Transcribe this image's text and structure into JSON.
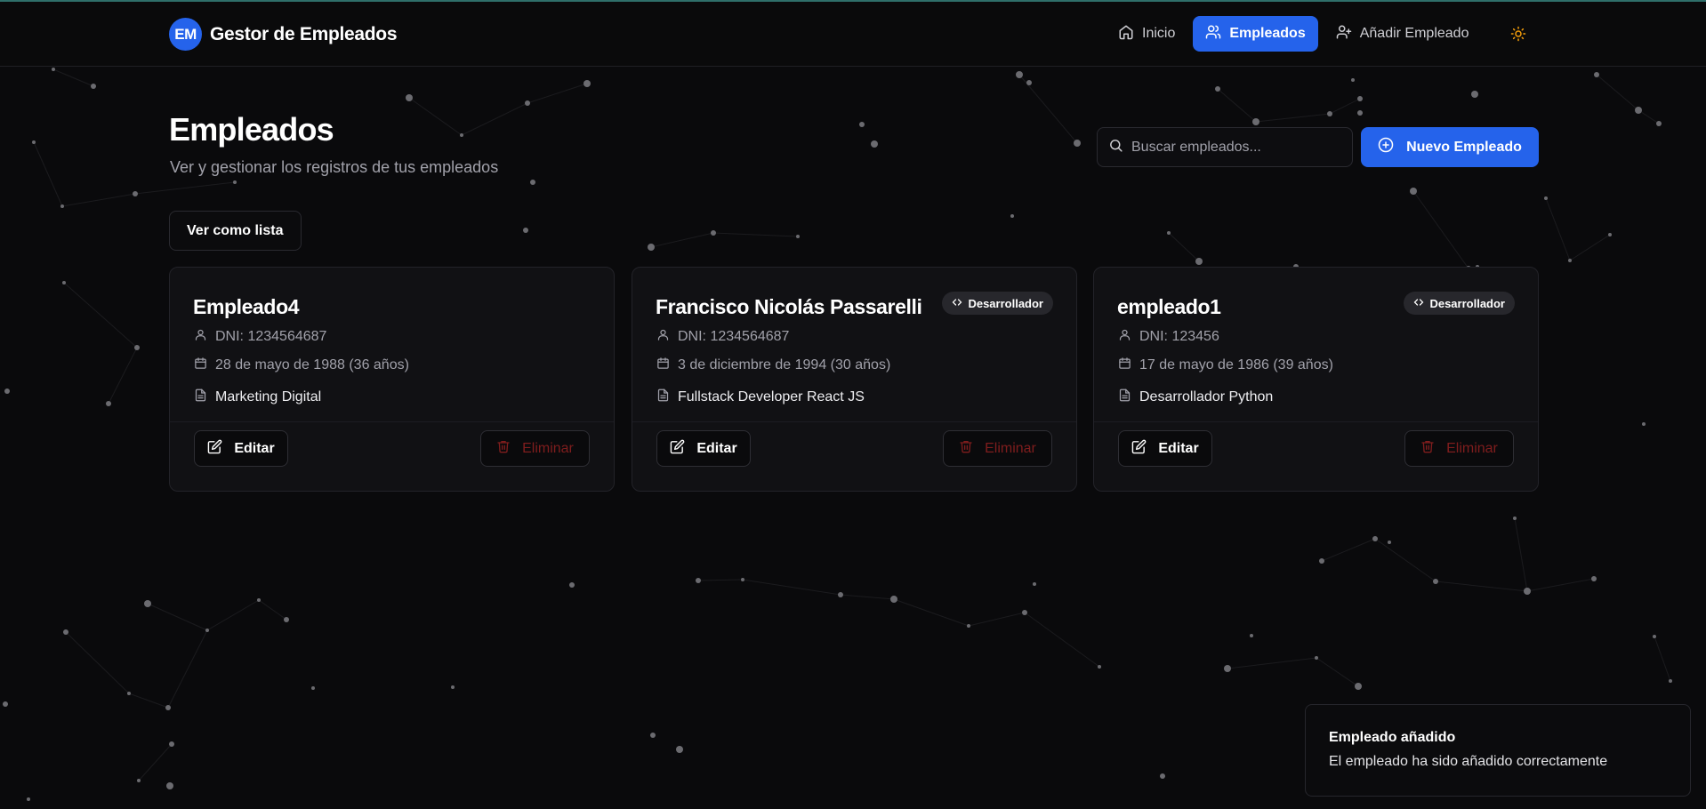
{
  "app": {
    "logo_initials": "EM",
    "title": "Gestor de Empleados"
  },
  "nav": {
    "items": [
      {
        "label": "Inicio",
        "icon": "home-icon",
        "active": false
      },
      {
        "label": "Empleados",
        "icon": "users-icon",
        "active": true
      },
      {
        "label": "Añadir Empleado",
        "icon": "user-plus-icon",
        "active": false
      }
    ],
    "theme_toggle_icon": "sun-icon"
  },
  "page": {
    "title": "Empleados",
    "subtitle": "Ver y gestionar los registros de tus empleados",
    "search_placeholder": "Buscar empleados...",
    "new_button_label": "Nuevo Empleado",
    "view_toggle_label": "Ver como lista"
  },
  "employees": [
    {
      "name": "Empleado4",
      "badge": "",
      "dni": "DNI: 1234564687",
      "birth": "28 de mayo de 1988 (36 años)",
      "role": "Marketing Digital",
      "edit_label": "Editar",
      "delete_label": "Eliminar"
    },
    {
      "name": "Francisco Nicolás Passarelli",
      "badge": "Desarrollador",
      "dni": "DNI: 1234564687",
      "birth": "3 de diciembre de 1994 (30 años)",
      "role": "Fullstack Developer React JS",
      "edit_label": "Editar",
      "delete_label": "Eliminar"
    },
    {
      "name": "empleado1",
      "badge": "Desarrollador",
      "dni": "DNI: 123456",
      "birth": "17 de mayo de 1986 (39 años)",
      "role": "Desarrollador Python",
      "edit_label": "Editar",
      "delete_label": "Eliminar"
    }
  ],
  "toast": {
    "title": "Empleado añadido",
    "description": "El empleado ha sido añadido correctamente"
  },
  "colors": {
    "accent": "#2563eb",
    "background": "#0a0a0c",
    "card": "#111114",
    "danger": "#7f1d1d",
    "sun": "#f59e0b"
  }
}
